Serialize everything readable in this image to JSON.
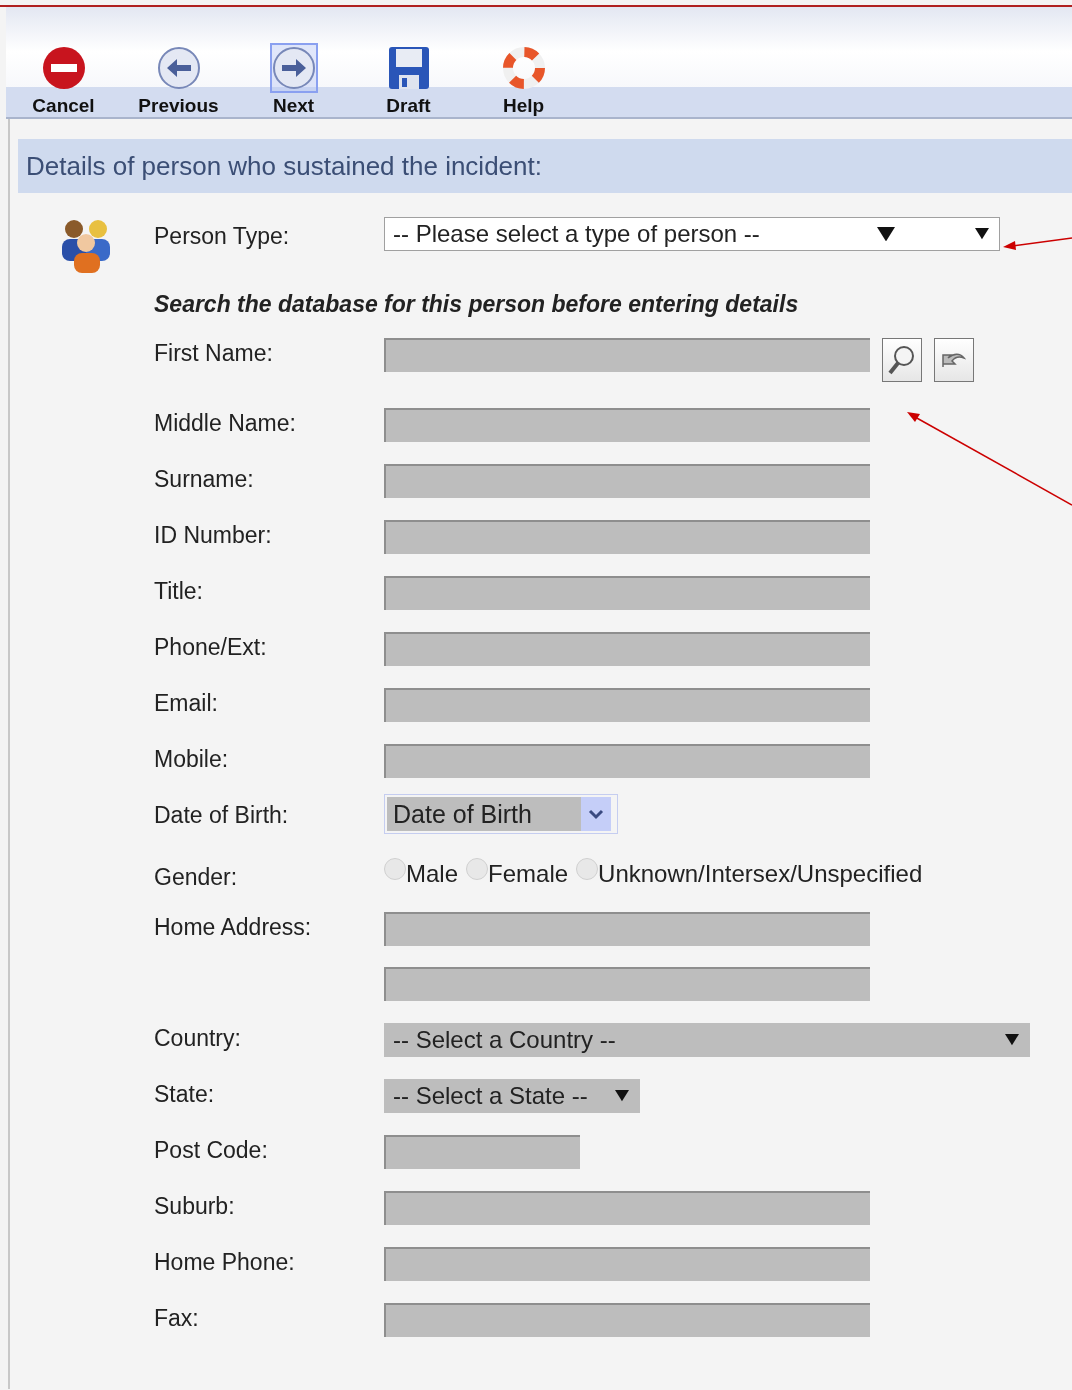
{
  "toolbar": [
    {
      "kind": "cancel",
      "label": "Cancel",
      "highlighted": false
    },
    {
      "kind": "previous",
      "label": "Previous",
      "highlighted": false
    },
    {
      "kind": "next",
      "label": "Next",
      "highlighted": true
    },
    {
      "kind": "draft",
      "label": "Draft",
      "highlighted": false
    },
    {
      "kind": "help",
      "label": "Help",
      "highlighted": false
    }
  ],
  "section": {
    "title": "Details of person who sustained the incident:"
  },
  "person_type": {
    "label": "Person Type:",
    "value": "-- Please select a type of person --"
  },
  "search_hint": "Search the database for this person before entering details",
  "fields": [
    {
      "kind": "search",
      "label": "First Name:"
    },
    {
      "kind": "text",
      "label": "Middle Name:"
    },
    {
      "kind": "text",
      "label": "Surname:"
    },
    {
      "kind": "text",
      "label": "ID Number:"
    },
    {
      "kind": "text",
      "label": "Title:"
    },
    {
      "kind": "text",
      "label": "Phone/Ext:"
    },
    {
      "kind": "text",
      "label": "Email:"
    },
    {
      "kind": "text",
      "label": "Mobile:"
    },
    {
      "kind": "date",
      "label": "Date of Birth:",
      "value": "Date of Birth"
    },
    {
      "kind": "radio",
      "label": "Gender:",
      "options": [
        {
          "label": "Male",
          "selected": false
        },
        {
          "label": "Female",
          "selected": false
        },
        {
          "label": "Unknown/Intersex/Unspecified",
          "selected": false
        }
      ]
    },
    {
      "kind": "address",
      "label": "Home Address:"
    },
    {
      "kind": "select-wide",
      "label": "Country:",
      "value": "-- Select a Country --"
    },
    {
      "kind": "select-narrow",
      "label": "State:",
      "value": "-- Select a State --"
    },
    {
      "kind": "short",
      "label": "Post Code:"
    },
    {
      "kind": "text",
      "label": "Suburb:"
    },
    {
      "kind": "text",
      "label": "Home Phone:"
    },
    {
      "kind": "text",
      "label": "Fax:"
    }
  ]
}
